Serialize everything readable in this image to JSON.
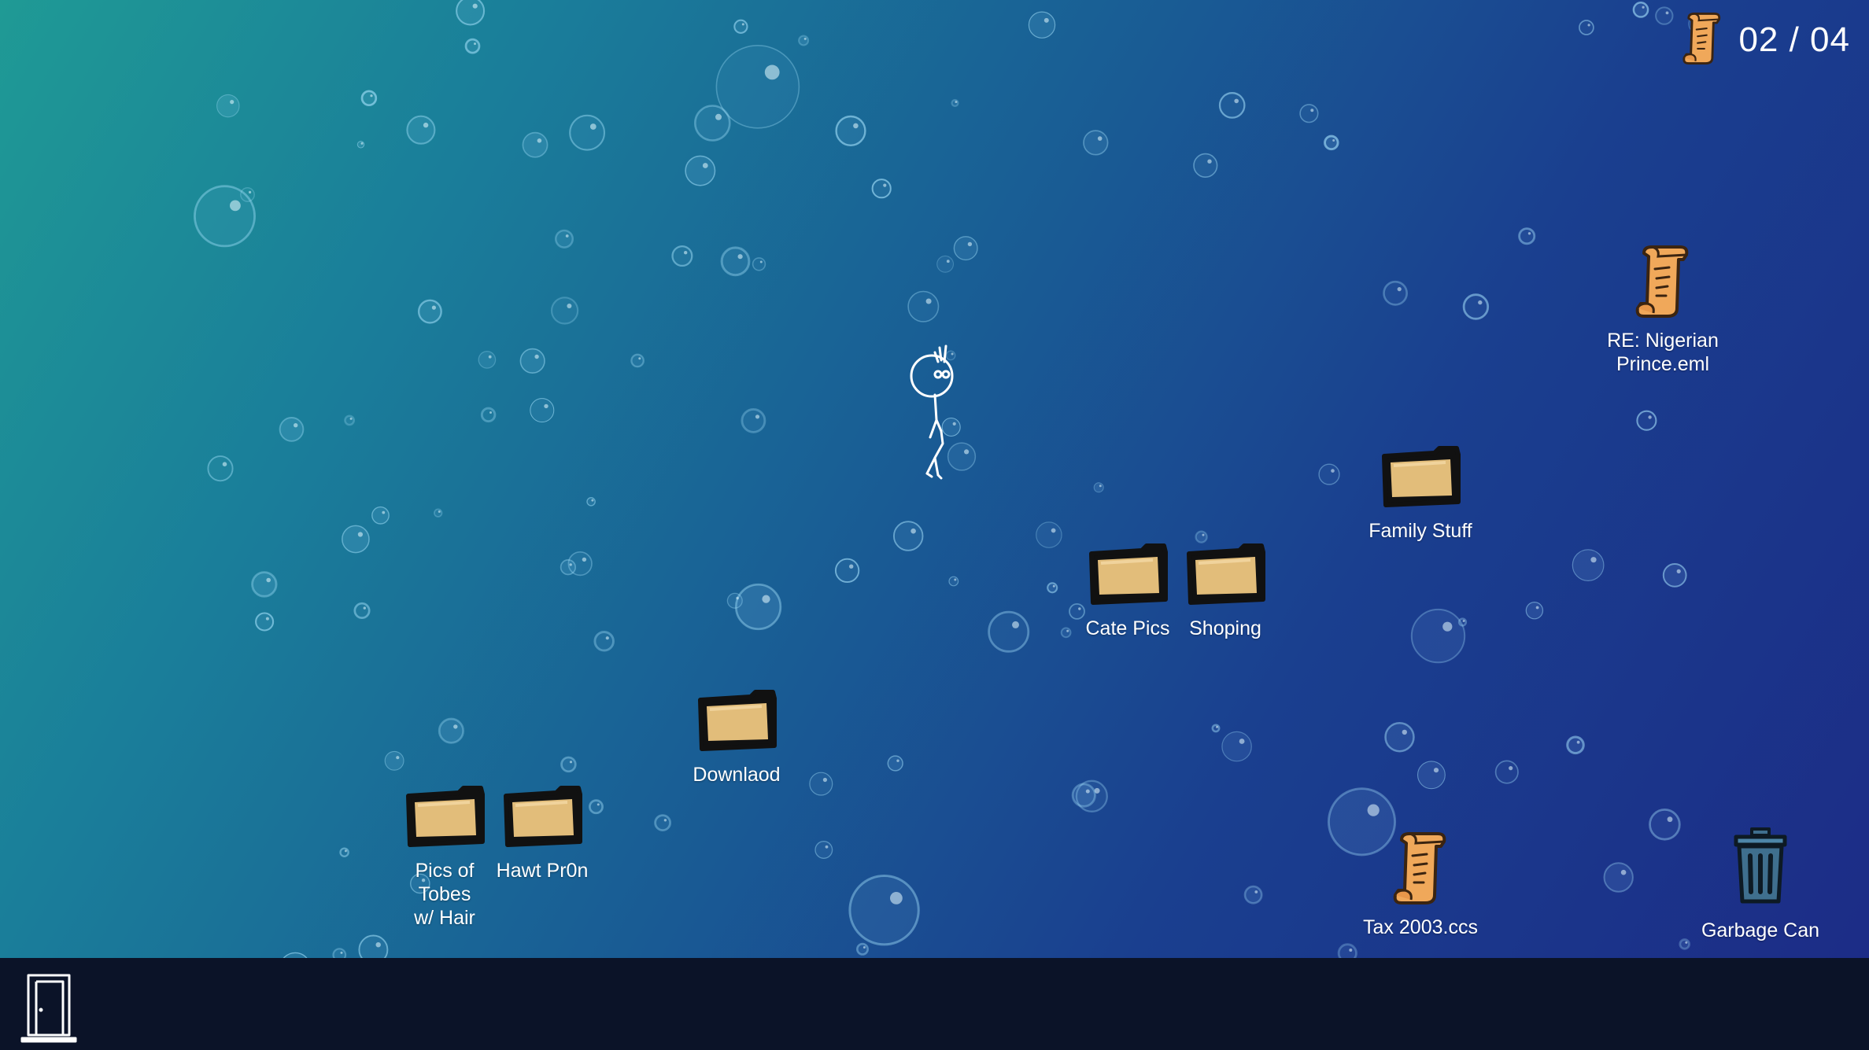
{
  "counter": {
    "icon": "scroll-icon",
    "text": "02 / 04"
  },
  "desktop": {
    "icons": [
      {
        "id": "re-nigerian-prince",
        "type": "scroll",
        "label": "RE: Nigerian\nPrince.eml"
      },
      {
        "id": "family-stuff",
        "type": "folder",
        "label": "Family Stuff"
      },
      {
        "id": "cate-pics",
        "type": "folder",
        "label": "Cate Pics"
      },
      {
        "id": "shoping",
        "type": "folder",
        "label": "Shoping"
      },
      {
        "id": "downlaod",
        "type": "folder",
        "label": "Downlaod"
      },
      {
        "id": "pics-of-tobes",
        "type": "folder",
        "label": "Pics of\nTobes\nw/ Hair"
      },
      {
        "id": "hawt-pr0n",
        "type": "folder",
        "label": "Hawt Pr0n"
      },
      {
        "id": "tax-2003",
        "type": "scroll",
        "label": "Tax 2003.ccs"
      },
      {
        "id": "garbage-can",
        "type": "trash",
        "label": "Garbage Can"
      }
    ]
  },
  "player": {
    "icon": "stick-figure-icon"
  },
  "taskbar": {
    "exit_icon": "door-icon"
  },
  "colors": {
    "background_start": "#1f9a95",
    "background_end": "#1c2b86",
    "taskbar": "#0b1328",
    "folder_fill": "#e2bd7a",
    "scroll_fill": "#f0a85a",
    "trash_fill": "#3f6f8e"
  }
}
